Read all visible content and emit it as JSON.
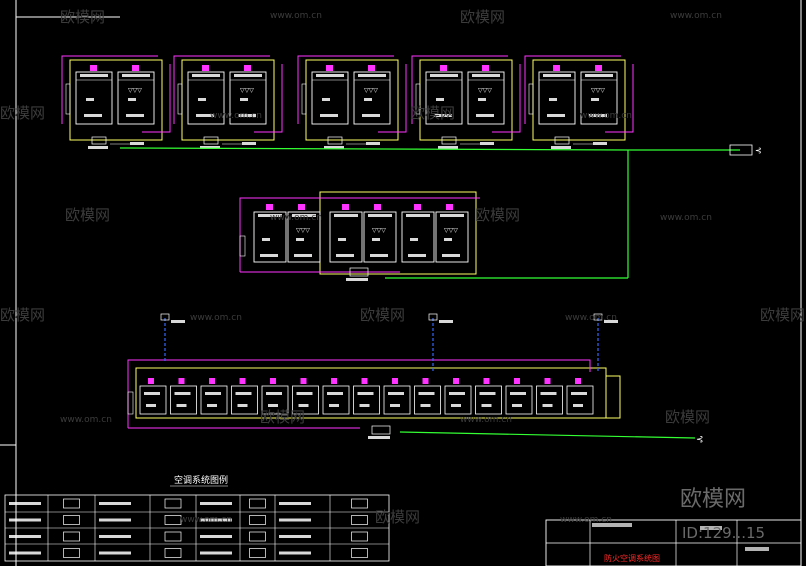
{
  "legend": {
    "title": "空调系统图例"
  },
  "title_block": {
    "drawing_name": "防火空调系统图"
  },
  "watermarks": {
    "brand": "欧模网",
    "url": "www.om.cn",
    "id_text": "ID:129...15"
  },
  "colors": {
    "frame": "#ffffff",
    "unit_box": "#ffff66",
    "duct_magenta": "#ff33ff",
    "pipe_green": "#33ff33",
    "riser_blue": "#3366ff",
    "text_red": "#ff2a2a",
    "watermark": "#3c3c3c"
  }
}
